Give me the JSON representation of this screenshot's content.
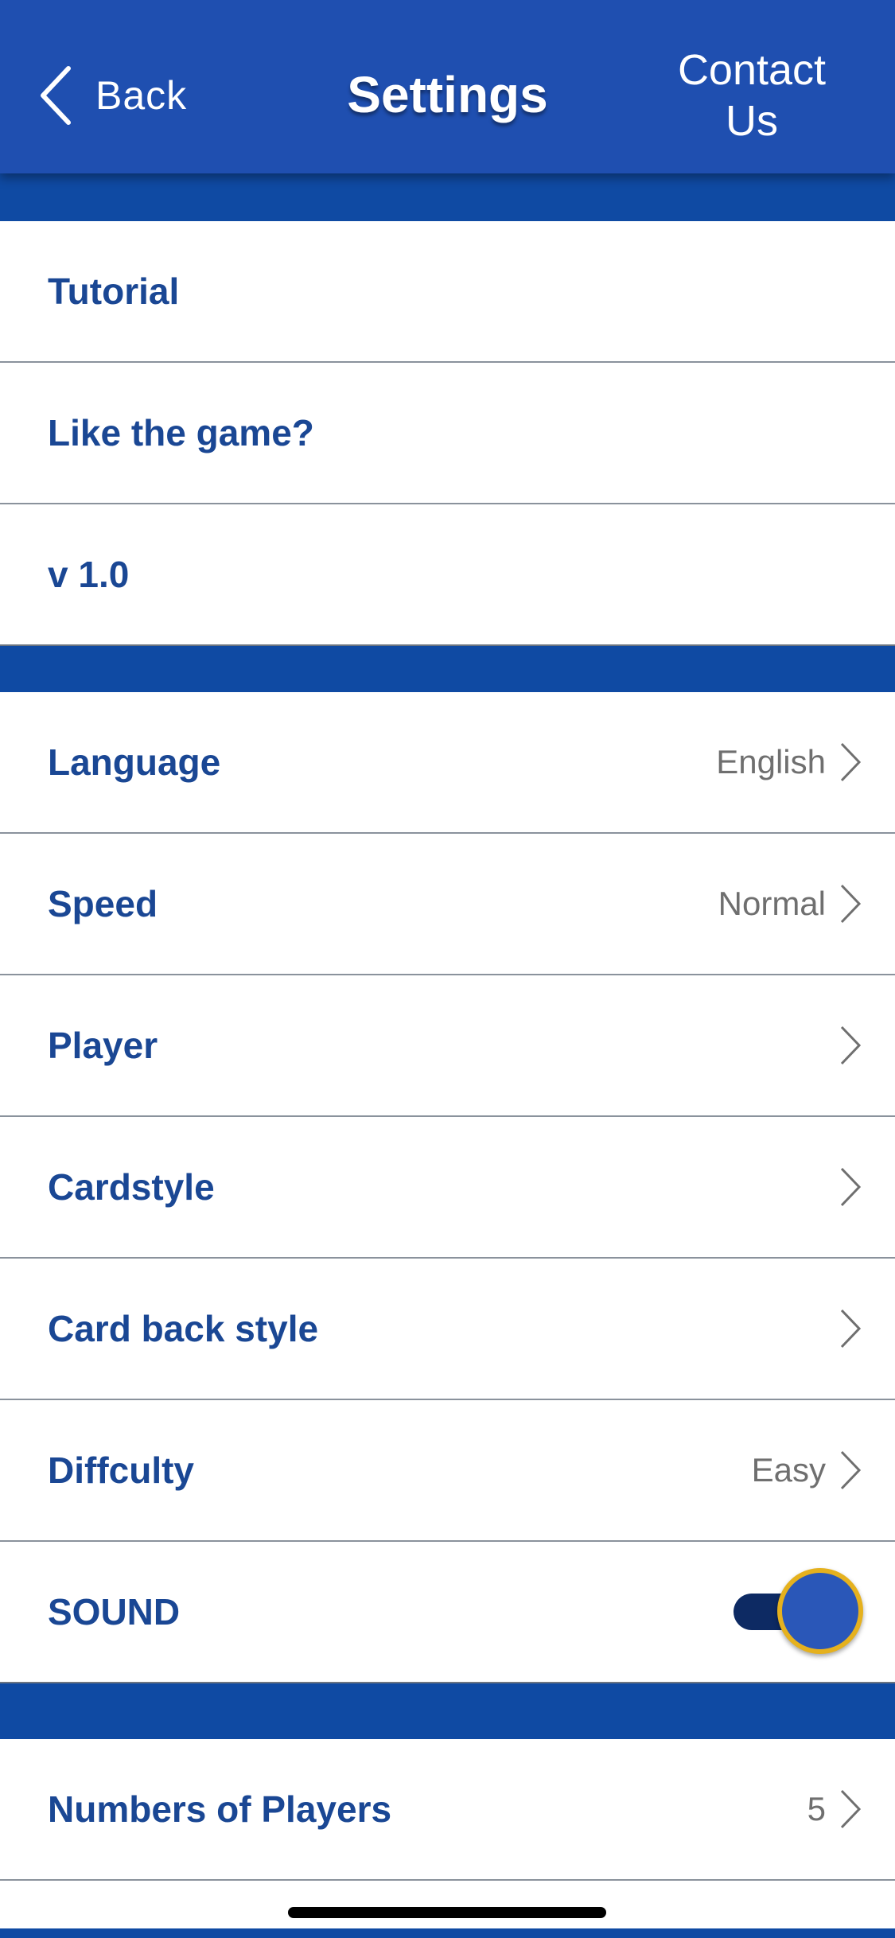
{
  "header": {
    "back_label": "Back",
    "title": "Settings",
    "contact_line1": "Contact",
    "contact_line2": "Us"
  },
  "group1": [
    {
      "label": "Tutorial"
    },
    {
      "label": "Like the game?"
    },
    {
      "label": "v 1.0"
    }
  ],
  "group2": [
    {
      "label": "Language",
      "value": "English"
    },
    {
      "label": "Speed",
      "value": "Normal"
    },
    {
      "label": "Player",
      "value": ""
    },
    {
      "label": "Cardstyle",
      "value": ""
    },
    {
      "label": "Card back style",
      "value": ""
    },
    {
      "label": "Diffculty",
      "value": "Easy"
    },
    {
      "label": "SOUND",
      "toggle_on": true
    }
  ],
  "group3": [
    {
      "label": "Numbers of Players",
      "value": "5"
    }
  ],
  "colors": {
    "header_bg": "#1f4fb0",
    "section_bg": "#0f4aa3",
    "label_text": "#1a4794",
    "toggle_knob_border": "#e5b11e"
  },
  "icons": {
    "back": "chevron-left-icon",
    "row_disclosure": "chevron-right-icon"
  }
}
